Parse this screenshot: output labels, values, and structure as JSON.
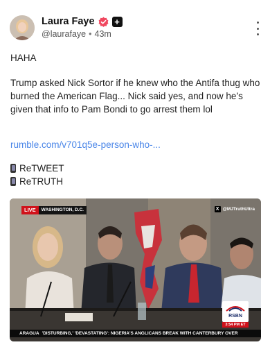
{
  "author": {
    "name": "Laura Faye",
    "handle": "@laurafaye",
    "time": "43m"
  },
  "post": {
    "line1": "HAHA",
    "line2": "Trump asked Nick Sortor if he knew who the Antifa thug who burned the American Flag... Nick said yes, and now he’s given that info to Pam Bondi to go arrest them lol",
    "link": "rumble.com/v701q5e-person-who-...",
    "retweet": "ReTWEET",
    "retruth": "ReTRUTH"
  },
  "video": {
    "live_label": "LIVE",
    "location": "WASHINGTON, D.C.",
    "credit": "@MJTruthUltra",
    "channel_logo": "RSBN",
    "time_label": "3:54 PM ET",
    "ticker_tag": "ARAGUA",
    "ticker_text": "'DISTURBING,' 'DEVASTATING': NIGERIA'S ANGLICANS BREAK WITH CANTERBURY OVER"
  },
  "icons": {
    "verified": "verified-badge-icon",
    "plus": "plus-badge-icon",
    "more": "more-options-icon",
    "phone": "mobile-phone-icon"
  },
  "colors": {
    "verified": "#f0465e",
    "link": "#4a86e8",
    "live": "#d0121b"
  }
}
